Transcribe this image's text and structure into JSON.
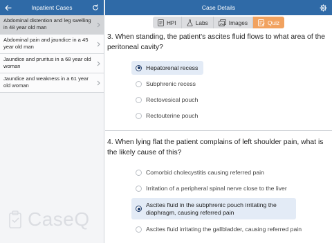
{
  "sidebar": {
    "title": "Inpatient Cases",
    "cases": [
      {
        "label": "Abdominal distention and leg swelling in 48 year old man",
        "selected": true
      },
      {
        "label": "Abdominal pain and jaundice in a 45 year old man",
        "selected": false
      },
      {
        "label": "Jaundice and pruritus in a 68 year old woman",
        "selected": false
      },
      {
        "label": "Jaundice and weakness in a 61 year old woman",
        "selected": false
      }
    ],
    "logo_text": "CaseQ"
  },
  "main": {
    "title": "Case Details",
    "tabs": [
      {
        "label": "HPI",
        "icon": "document-icon",
        "active": false
      },
      {
        "label": "Labs",
        "icon": "flask-icon",
        "active": false
      },
      {
        "label": "Images",
        "icon": "images-icon",
        "active": false
      },
      {
        "label": "Quiz",
        "icon": "quiz-icon",
        "active": true
      }
    ],
    "questions": [
      {
        "text": "3. When standing, the patient's ascites fluid flows to what area of the peritoneal cavity?",
        "options": [
          {
            "label": "Hepatorenal recess",
            "selected": true
          },
          {
            "label": "Subphrenic recess",
            "selected": false
          },
          {
            "label": "Rectovesical pouch",
            "selected": false
          },
          {
            "label": "Rectouterine pouch",
            "selected": false
          }
        ]
      },
      {
        "text": "4. When lying flat the patient complains of left shoulder pain, what is the likely cause of this?",
        "options": [
          {
            "label": "Comorbid cholecystitis causing referred pain",
            "selected": false
          },
          {
            "label": "Irritation of a peripheral spinal nerve close to the liver",
            "selected": false
          },
          {
            "label": "Ascites fluid in the subphrenic pouch irritating the diaphragm, causing referred pain",
            "selected": true
          },
          {
            "label": "Ascites fluid irritating the gallbladder, causing referred pain",
            "selected": false
          }
        ]
      }
    ]
  },
  "colors": {
    "header_blue": "#2f6aa7",
    "quiz_orange": "#f1a25f",
    "selected_option_bg": "#e3ebf6"
  }
}
